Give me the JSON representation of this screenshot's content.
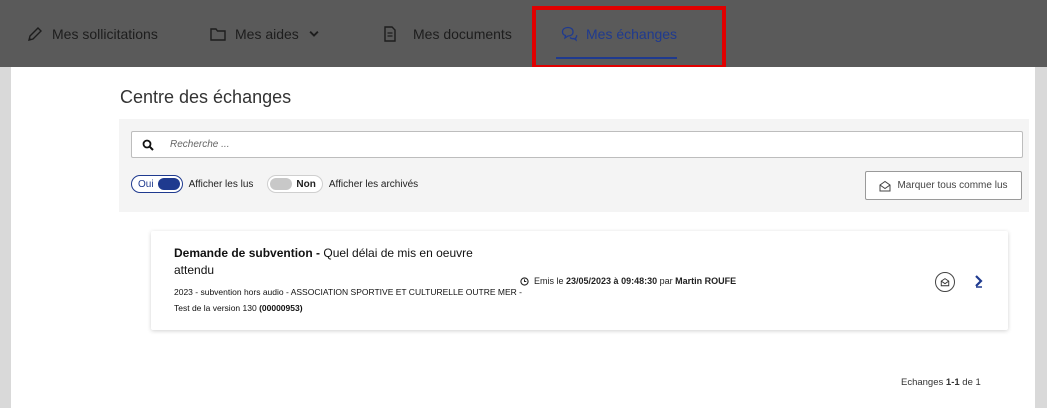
{
  "nav": {
    "items": [
      {
        "key": "sollicitations",
        "label": "Mes sollicitations",
        "icon": "pen-icon"
      },
      {
        "key": "aides",
        "label": "Mes aides",
        "icon": "folder-icon"
      },
      {
        "key": "documents",
        "label": "Mes documents",
        "icon": "document-icon"
      },
      {
        "key": "echanges",
        "label": "Mes échanges",
        "icon": "chat-icon",
        "active": true
      }
    ]
  },
  "page": {
    "title": "Centre des échanges"
  },
  "search": {
    "placeholder": "Recherche ..."
  },
  "filters": {
    "read_toggle_label": "Oui",
    "read_text": "Afficher les lus",
    "archived_toggle_label": "Non",
    "archived_text": "Afficher les archivés"
  },
  "mark_all_button": {
    "label": "Marquer tous comme lus"
  },
  "exchange": {
    "title_bold": "Demande de subvention -",
    "title_rest": " Quel délai de mis en oeuvre attendu",
    "sub_line": "2023 - subvention hors audio - ASSOCIATION SPORTIVE ET CULTURELLE OUTRE MER - Test de la version 130 ",
    "sub_code": "(00000953)",
    "meta_prefix": "Emis le ",
    "meta_datetime": "23/05/2023 à 09:48:30",
    "meta_by": " par ",
    "meta_author": "Martin ROUFE"
  },
  "pagination": {
    "prefix": "Echanges ",
    "range": "1-1",
    "suffix": " de 1"
  },
  "colors": {
    "accent": "#1f3a8f",
    "nav_bg": "#5a5a5a",
    "highlight": "#e00000"
  }
}
